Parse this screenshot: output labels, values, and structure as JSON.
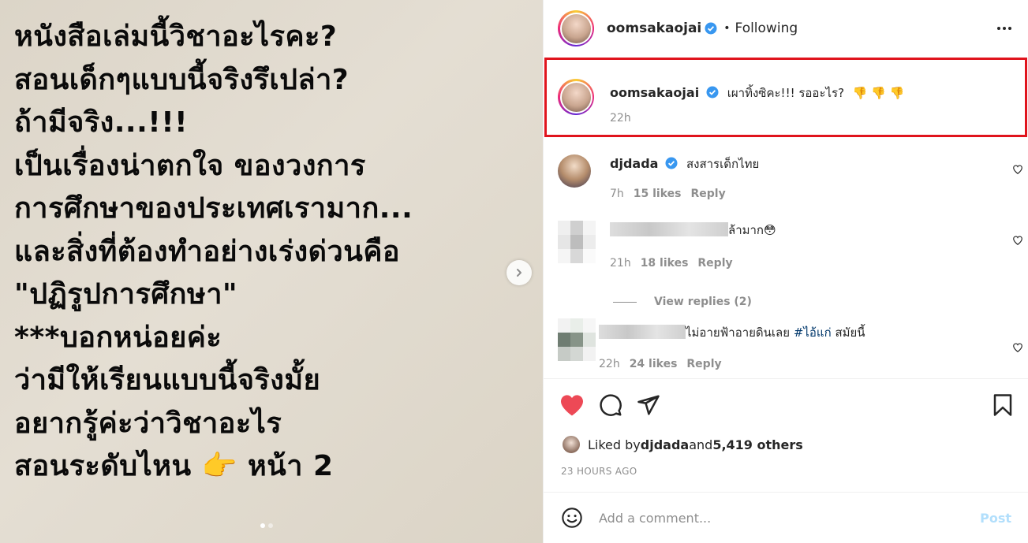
{
  "photo": {
    "lines": [
      "หนังสือเล่มนี้วิชาอะไรคะ?",
      "สอนเด็กๆแบบนี้จริงรึเปล่า?",
      "ถ้ามีจริง...!!!",
      "เป็นเรื่องน่าตกใจ ของวงการ",
      "การศึกษาของประเทศเรามาก...",
      "และสิ่งที่ต้องทำอย่างเร่งด่วนคือ",
      "\"ปฏิรูปการศึกษา\"",
      "***บอกหน่อยค่ะ",
      "ว่ามีให้เรียนแบบนี้จริงมั้ย",
      "อยากรู้ค่ะว่าวิชาอะไร",
      "สอนระดับไหน 👉 หน้า 2"
    ]
  },
  "header": {
    "username": "oomsakaojai",
    "separator": "•",
    "following": "Following"
  },
  "caption": {
    "username": "oomsakaojai",
    "text": "เผาทิ้งซิคะ!!! รออะไร?",
    "emoji": "👎 👎 👎",
    "time": "22h"
  },
  "comments": [
    {
      "username": "djdada",
      "text": "สงสารเด็กไทย",
      "time": "7h",
      "likes": "15 likes",
      "reply": "Reply"
    },
    {
      "username": "",
      "text": "ล้ามาก😳",
      "time": "21h",
      "likes": "18 likes",
      "reply": "Reply"
    },
    {
      "username": "",
      "text": "ไม่อายฟ้าอายดินเลย",
      "hashtag": "#ไอ้แก่",
      "text_after": " สมัยนี้",
      "time": "22h",
      "likes": "24 likes",
      "reply": "Reply"
    }
  ],
  "view_replies": "View replies (2)",
  "likes": {
    "prefix": "Liked by ",
    "user": "djdada",
    "middle": " and ",
    "others": "5,419 others"
  },
  "posted_ago": "23 HOURS AGO",
  "add_comment": {
    "placeholder": "Add a comment...",
    "post_label": "Post"
  },
  "colors": {
    "highlight_border": "#e0141d",
    "like_red": "#ed4956",
    "verified_blue": "#3897f0",
    "post_disabled": "#b2dffc"
  },
  "icons": [
    "chevron-right-icon",
    "verified-icon",
    "more-icon",
    "heart-icon",
    "comment-icon",
    "share-icon",
    "bookmark-icon",
    "emoji-icon"
  ]
}
